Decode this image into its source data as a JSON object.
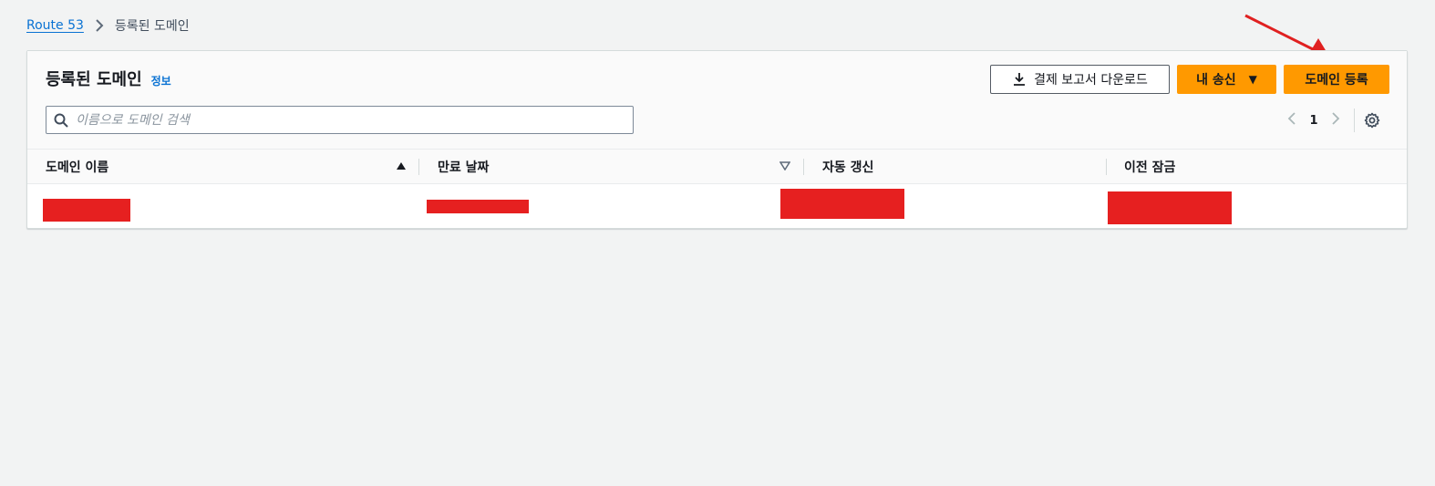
{
  "breadcrumb": {
    "root": "Route 53",
    "current": "등록된 도메인"
  },
  "panel": {
    "title": "등록된 도메인",
    "info_link": "정보",
    "buttons": {
      "download_report": "결제 보고서 다운로드",
      "my_transfers": "내 송신",
      "register_domain": "도메인 등록"
    },
    "search": {
      "placeholder": "이름으로 도메인 검색",
      "value": ""
    },
    "pagination": {
      "current_page": "1"
    }
  },
  "table": {
    "columns": [
      "도메인 이름",
      "만료 날짜",
      "자동 갱신",
      "이전 잠금"
    ],
    "sort": {
      "sorted_column": "도메인 이름",
      "direction": "ascending"
    }
  },
  "colors": {
    "accent_orange": "#ff9900",
    "link_blue": "#0972d3",
    "redaction_red": "#e62020",
    "annotation_arrow": "#e02020"
  },
  "icons": [
    "chevron-right-icon",
    "download-icon",
    "caret-down-icon",
    "search-icon",
    "chevron-left-icon",
    "settings-gear-icon",
    "sort-ascending-icon",
    "sort-descending-icon"
  ]
}
